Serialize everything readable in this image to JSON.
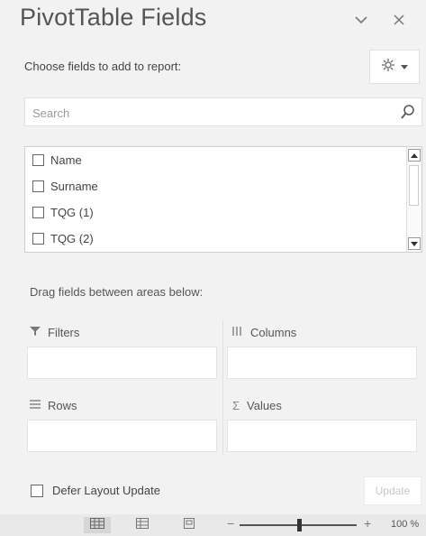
{
  "pane": {
    "title": "PivotTable Fields",
    "choose_label": "Choose fields to add to report:",
    "search_placeholder": "Search",
    "fields": [
      {
        "label": "Name",
        "checked": false
      },
      {
        "label": "Surname",
        "checked": false
      },
      {
        "label": "TQG (1)",
        "checked": false
      },
      {
        "label": "TQG (2)",
        "checked": false
      }
    ],
    "drag_label": "Drag fields between areas below:",
    "areas": {
      "filters": "Filters",
      "columns": "Columns",
      "rows": "Rows",
      "values": "Values"
    },
    "defer_label": "Defer Layout Update",
    "update_label": "Update"
  },
  "statusbar": {
    "zoom_level": "100 %"
  },
  "icons": {
    "collapse": "chevron-down-icon",
    "close": "close-icon",
    "settings": "gear-icon",
    "search": "search-icon",
    "filters": "filter-icon",
    "columns": "columns-icon",
    "rows": "rows-icon",
    "values": "sigma-icon"
  },
  "colors": {
    "pane_bg": "#f2f2f2",
    "statusbar_bg": "#e9e9e9"
  }
}
